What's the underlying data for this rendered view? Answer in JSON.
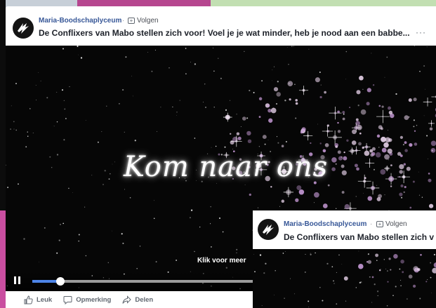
{
  "post": {
    "page_name": "Maria-Boodschaplyceum",
    "separator": "·",
    "follow_label": "Volgen",
    "follow_icon": "follow-plus-icon",
    "text": "De Conflixers van Mabo stellen zich voor! Voel je je wat minder, heb je nood aan een babbe...",
    "more_label": "···",
    "video": {
      "title_text": "Kom naar ons",
      "click_more": "Klik voor meer",
      "progress": 0.12
    },
    "actions": [
      {
        "label": "Leuk",
        "icon": "like-icon"
      },
      {
        "label": "Opmerking",
        "icon": "comment-icon"
      },
      {
        "label": "Delen",
        "icon": "share-icon"
      }
    ]
  },
  "overlay_post": {
    "page_name": "Maria-Boodschaplyceum",
    "separator": "·",
    "follow_label": "Volgen",
    "text": "De Conflixers van Mabo stellen zich v"
  },
  "colors": {
    "link_blue": "#385898",
    "progress_blue": "#4d84e8",
    "magenta_strip": "#b6468f",
    "green_strip": "#c2dfb2",
    "sparkle_pink": "#c89bd8"
  }
}
